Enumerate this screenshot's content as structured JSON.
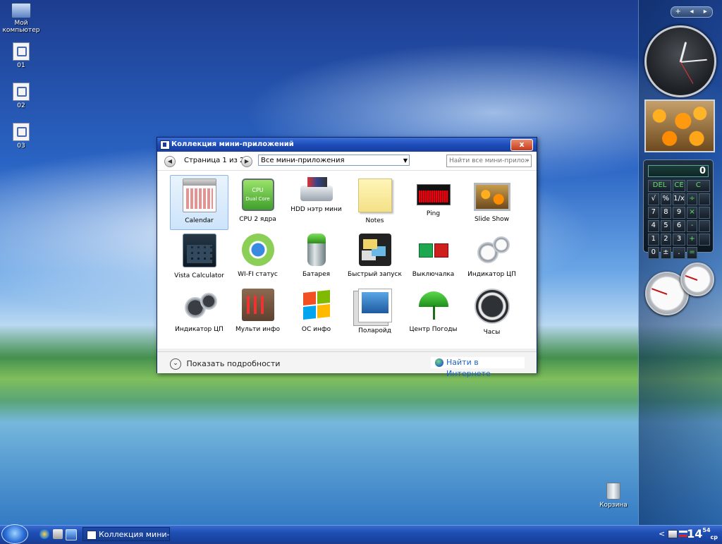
{
  "desktop": {
    "icons": [
      {
        "label": "Мой компьютер",
        "icon": "computer-icon"
      },
      {
        "label": "01",
        "icon": "document-icon"
      },
      {
        "label": "02",
        "icon": "document-icon"
      },
      {
        "label": "03",
        "icon": "document-icon"
      }
    ],
    "recycle_bin": "Корзина"
  },
  "sidebar": {
    "controls": [
      "+",
      "◂",
      "▸"
    ],
    "calculator": {
      "display": "0",
      "keys": [
        "DEL",
        "CE",
        "C",
        "√",
        "%",
        "1/x",
        "÷",
        "7",
        "8",
        "9",
        "×",
        "4",
        "5",
        "6",
        "-",
        "1",
        "2",
        "3",
        "+",
        "0",
        "±",
        ".",
        "="
      ]
    }
  },
  "window": {
    "title": "Коллекция мини-приложений",
    "close": "x",
    "page_info": "Страница 1 из 2",
    "filter": "Все мини-приложения",
    "search_placeholder": "Найти все мини-приложения",
    "gadgets": [
      {
        "label": "Calendar",
        "icon": "calendar-icon",
        "selected": true
      },
      {
        "label": "CPU 2 ядра",
        "icon": "cpu-icon",
        "badge": "CPU",
        "sub": "Dual Core"
      },
      {
        "label": "HDD нэтр мини",
        "icon": "hdd-icon"
      },
      {
        "label": "Notes",
        "icon": "notes-icon"
      },
      {
        "label": "Ping",
        "icon": "ping-icon"
      },
      {
        "label": "Slide Show",
        "icon": "slideshow-icon"
      },
      {
        "label": "Vista Calculator",
        "icon": "calculator-icon"
      },
      {
        "label": "WI-FI статус",
        "icon": "wifi-icon"
      },
      {
        "label": "Батарея",
        "icon": "battery-icon"
      },
      {
        "label": "Быстрый запуск",
        "icon": "quick-launch-icon"
      },
      {
        "label": "Выключалка",
        "icon": "shutdown-icon"
      },
      {
        "label": "Индикатор ЦП",
        "icon": "gauges-icon"
      },
      {
        "label": "Индикатор ЦП",
        "icon": "cpu-meter-icon"
      },
      {
        "label": "Мульти инфо",
        "icon": "multi-info-icon"
      },
      {
        "label": "ОС инфо",
        "icon": "windows-logo-icon"
      },
      {
        "label": "Поларойд",
        "icon": "polaroid-icon"
      },
      {
        "label": "Центр Погоды",
        "icon": "weather-umbrella-icon"
      },
      {
        "label": "Часы",
        "icon": "clock-icon"
      }
    ],
    "show_details": "Показать подробности",
    "get_online": "Найти в Интернете"
  },
  "taskbar": {
    "task_label": "Коллекция мини-п...",
    "tray_arrow": "<",
    "clock": "14",
    "clock_sup": "54",
    "clock_sub": "ср"
  }
}
